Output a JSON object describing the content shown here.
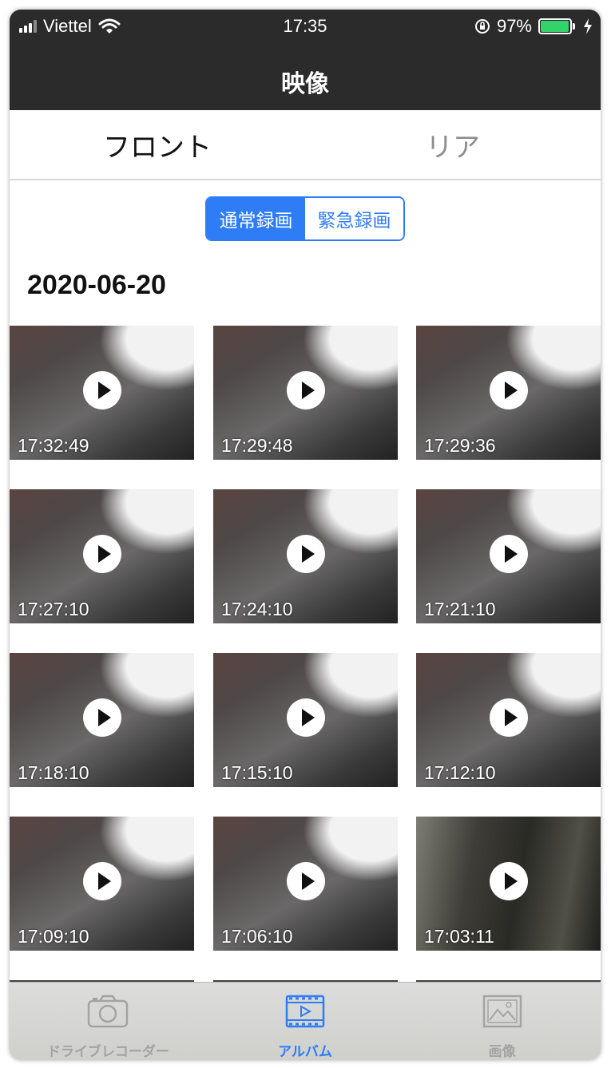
{
  "status_bar": {
    "carrier": "Viettel",
    "time": "17:35",
    "battery_text": "97%",
    "battery_level": 0.97,
    "battery_color": "#33d26b"
  },
  "nav": {
    "title": "映像"
  },
  "camera_tabs": [
    {
      "label": "フロント",
      "selected": true
    },
    {
      "label": "リア",
      "selected": false
    }
  ],
  "record_type": {
    "options": [
      "通常録画",
      "緊急録画"
    ],
    "selected": "通常録画",
    "accent_color": "#2e7cf6"
  },
  "date_heading": "2020-06-20",
  "videos": [
    {
      "time": "17:32:49",
      "icon": "play-icon"
    },
    {
      "time": "17:29:48",
      "icon": "play-icon"
    },
    {
      "time": "17:29:36",
      "icon": "play-icon"
    },
    {
      "time": "17:27:10",
      "icon": "play-icon"
    },
    {
      "time": "17:24:10",
      "icon": "play-icon"
    },
    {
      "time": "17:21:10",
      "icon": "play-icon"
    },
    {
      "time": "17:18:10",
      "icon": "play-icon"
    },
    {
      "time": "17:15:10",
      "icon": "play-icon"
    },
    {
      "time": "17:12:10",
      "icon": "play-icon"
    },
    {
      "time": "17:09:10",
      "icon": "play-icon"
    },
    {
      "time": "17:06:10",
      "icon": "play-icon"
    },
    {
      "time": "17:03:11",
      "icon": "play-icon"
    }
  ],
  "tab_bar": [
    {
      "label": "ドライブレコーダー",
      "icon": "camera-icon",
      "selected": false
    },
    {
      "label": "アルバム",
      "icon": "film-icon",
      "selected": true
    },
    {
      "label": "画像",
      "icon": "image-icon",
      "selected": false
    }
  ]
}
